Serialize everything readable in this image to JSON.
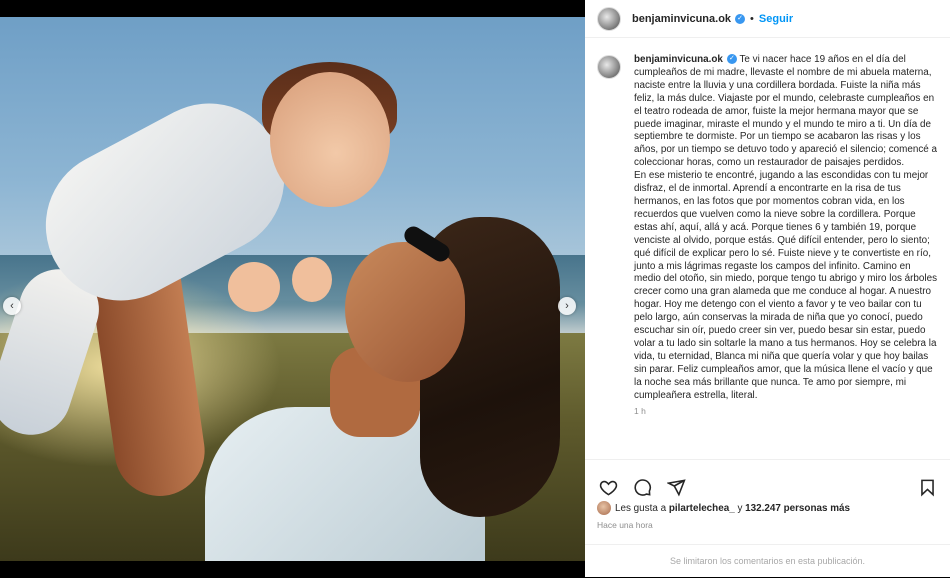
{
  "post": {
    "username": "benjaminvicuna.ok",
    "verified_icon": "verified-badge-icon",
    "separator": "•",
    "follow_label": "Seguir"
  },
  "media": {
    "carousel_total": 3,
    "carousel_active": 2,
    "prev_icon": "chevron-left-icon",
    "next_icon": "chevron-right-icon"
  },
  "caption": {
    "username": "benjaminvicuna.ok",
    "text": "Te vi nacer hace 19 años en el día del cumpleaños de mi madre, llevaste el nombre de mi abuela materna, naciste entre la lluvia y una cordillera bordada. Fuiste la niña más feliz, la más dulce. Viajaste por el mundo, celebraste cumpleaños en el teatro rodeada de amor, fuiste la mejor hermana mayor que se puede imaginar, miraste el mundo y el mundo te miro a ti. Un día de septiembre te dormiste. Por un tiempo se acabaron las risas y los años, por un tiempo se detuvo todo y apareció el silencio; comencé a coleccionar horas, como un restaurador de paisajes perdidos.\nEn ese misterio te encontré, jugando a las escondidas con tu mejor disfraz, el de inmortal. Aprendí a encontrarte en la risa de tus hermanos, en las fotos que por momentos cobran vida, en los recuerdos que vuelven como la nieve sobre la cordillera. Porque estas ahí, aquí, allá y acá. Porque tienes 6 y también 19, porque venciste al olvido, porque estás. Qué difícil entender, pero lo siento; qué difícil de explicar pero lo sé. Fuiste nieve y te convertiste en río, junto a mis lágrimas regaste los campos del infinito. Camino en medio del otoño, sin miedo, porque tengo tu abrigo y miro los árboles crecer como una gran alameda que me conduce al hogar. A nuestro hogar. Hoy me detengo con el viento a favor y te veo bailar con tu pelo largo, aún conservas la mirada de niña que yo conocí, puedo escuchar sin oír, puedo creer sin ver, puedo besar sin estar, puedo volar a tu lado sin soltarle la mano a tus hermanos. Hoy se celebra la vida, tu eternidad, Blanca mi niña que quería volar y que hoy bailas sin parar. Feliz cumpleaños amor, que la música llene el vacío y que la noche sea más brillante que nunca. Te amo por siempre, mi cumpleañera estrella, literal.",
    "time_ago": "1 h"
  },
  "actions": {
    "like_icon": "heart-icon",
    "comment_icon": "comment-icon",
    "share_icon": "share-icon",
    "save_icon": "bookmark-icon"
  },
  "likes": {
    "prefix": "Les gusta a",
    "liker": "pilartelechea_",
    "middle": "y",
    "count": "132.247 personas más"
  },
  "date_label": "Hace una hora",
  "comments_notice": "Se limitaron los comentarios en esta publicación."
}
